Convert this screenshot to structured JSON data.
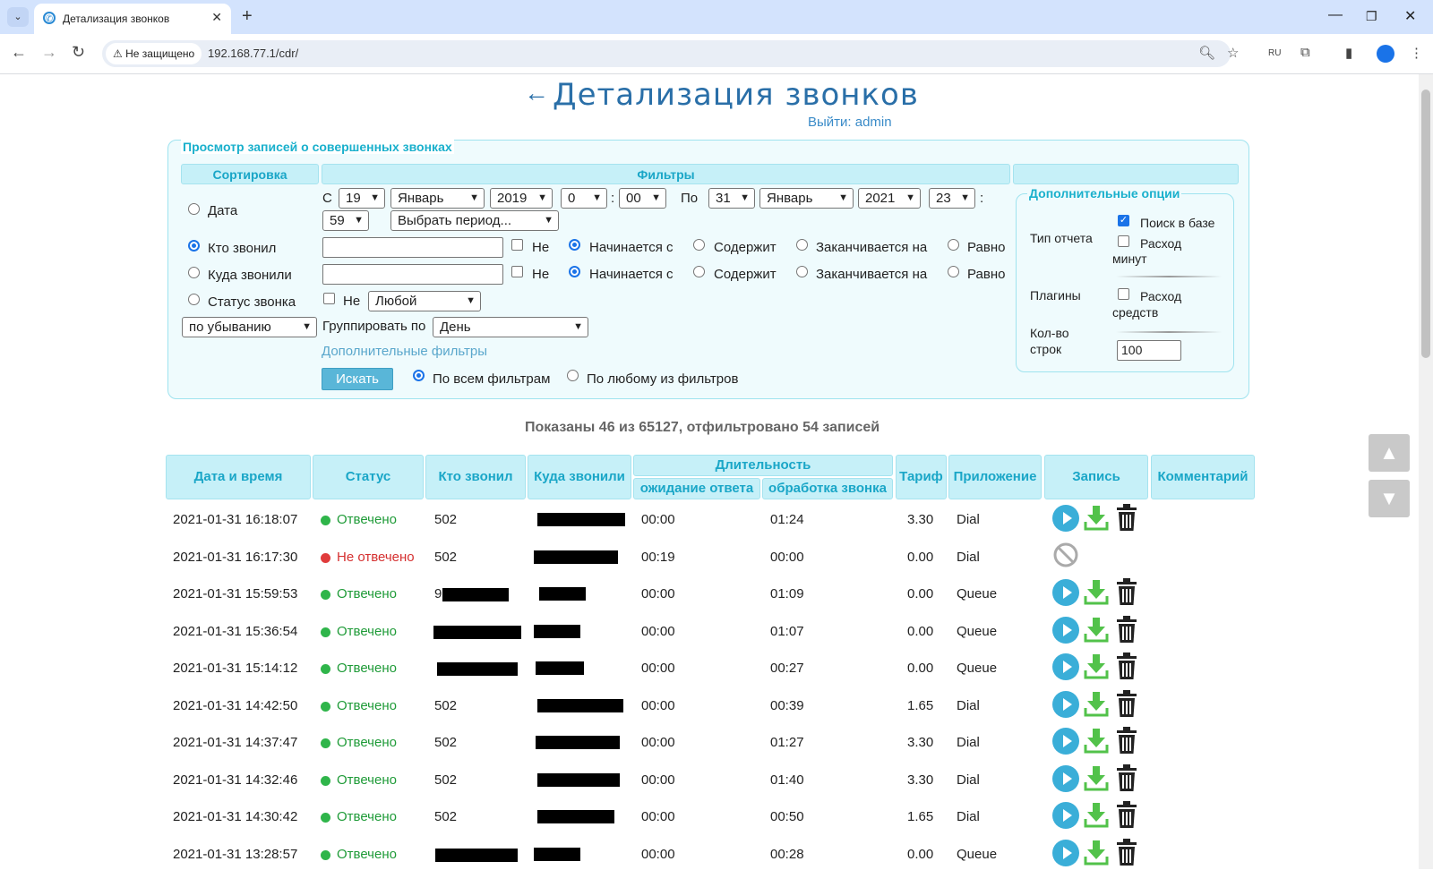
{
  "browser": {
    "tab_title": "Детализация звонков",
    "security_label": "Не защищено",
    "url": "192.168.77.1/cdr/",
    "ext_badge": "RU"
  },
  "page": {
    "title": "Детализация звонков",
    "back_arrow": "←",
    "logout": "Выйти: admin"
  },
  "filters": {
    "legend": "Просмотр записей о совершенных звонках",
    "sort_header": "Сортировка",
    "filters_header": "Фильтры",
    "sort_options": [
      "Дата",
      "Кто звонил",
      "Куда звонили",
      "Статус звонка"
    ],
    "sort_selected": "Кто звонил",
    "from_label": "С",
    "to_label": "По",
    "from": {
      "day": "19",
      "month": "Январь",
      "year": "2019",
      "hour": "0",
      "minute": "00"
    },
    "to": {
      "day": "31",
      "month": "Январь",
      "year": "2021",
      "hour": "23",
      "minute": "59"
    },
    "colon": ":",
    "period_select": "Выбрать период...",
    "not_label": "Не",
    "match_options": [
      "Начинается с",
      "Содержит",
      "Заканчивается на",
      "Равно"
    ],
    "status_select": "Любой",
    "order_select": "по убыванию",
    "group_label": "Группировать по",
    "group_select": "День",
    "more_filters": "Дополнительные фильтры",
    "search_button": "Искать",
    "match_all": "По всем фильтрам",
    "match_any": "По любому из фильтров"
  },
  "options": {
    "legend": "Дополнительные опции",
    "report_type_label": "Тип отчета",
    "search_db": "Поиск в базе",
    "minutes_line1": "Расход",
    "minutes_line2": "минут",
    "plugins_label": "Плагины",
    "funds_line1": "Расход",
    "funds_line2": "средств",
    "rows_label_line1": "Кол-во",
    "rows_label_line2": "строк",
    "rows_value": "100"
  },
  "summary": "Показаны 46 из 65127, отфильтровано 54 записей",
  "table": {
    "headers": {
      "datetime": "Дата и время",
      "status": "Статус",
      "caller": "Кто звонил",
      "callee": "Куда звонили",
      "duration": "Длительность",
      "wait": "ожидание ответа",
      "handle": "обработка звонка",
      "tariff": "Тариф",
      "app": "Приложение",
      "record": "Запись",
      "comment": "Комментарий"
    },
    "rows": [
      {
        "dt": "2021-01-31 16:18:07",
        "status": "Отвечено",
        "caller": "502",
        "wait": "00:00",
        "handle": "01:24",
        "tariff": "3.30",
        "app": "Dial"
      },
      {
        "dt": "2021-01-31 16:17:30",
        "status": "Не отвечено",
        "caller": "502",
        "wait": "00:19",
        "handle": "00:00",
        "tariff": "0.00",
        "app": "Dial"
      },
      {
        "dt": "2021-01-31 15:59:53",
        "status": "Отвечено",
        "caller": "9",
        "wait": "00:00",
        "handle": "01:09",
        "tariff": "0.00",
        "app": "Queue"
      },
      {
        "dt": "2021-01-31 15:36:54",
        "status": "Отвечено",
        "caller": "",
        "wait": "00:00",
        "handle": "01:07",
        "tariff": "0.00",
        "app": "Queue"
      },
      {
        "dt": "2021-01-31 15:14:12",
        "status": "Отвечено",
        "caller": "",
        "wait": "00:00",
        "handle": "00:27",
        "tariff": "0.00",
        "app": "Queue"
      },
      {
        "dt": "2021-01-31 14:42:50",
        "status": "Отвечено",
        "caller": "502",
        "wait": "00:00",
        "handle": "00:39",
        "tariff": "1.65",
        "app": "Dial"
      },
      {
        "dt": "2021-01-31 14:37:47",
        "status": "Отвечено",
        "caller": "502",
        "wait": "00:00",
        "handle": "01:27",
        "tariff": "3.30",
        "app": "Dial"
      },
      {
        "dt": "2021-01-31 14:32:46",
        "status": "Отвечено",
        "caller": "502",
        "wait": "00:00",
        "handle": "01:40",
        "tariff": "3.30",
        "app": "Dial"
      },
      {
        "dt": "2021-01-31 14:30:42",
        "status": "Отвечено",
        "caller": "502",
        "wait": "00:00",
        "handle": "00:50",
        "tariff": "1.65",
        "app": "Dial"
      },
      {
        "dt": "2021-01-31 13:28:57",
        "status": "Отвечено",
        "caller": "",
        "wait": "00:00",
        "handle": "00:28",
        "tariff": "0.00",
        "app": "Queue"
      }
    ]
  },
  "colors": {
    "answered": "#2fb54a",
    "missed": "#e03b3b",
    "accent": "#1aa6c7"
  },
  "icons": [
    "play-icon",
    "download-icon",
    "trash-icon",
    "no-entry-icon",
    "arrow-up-icon",
    "arrow-down-icon"
  ]
}
